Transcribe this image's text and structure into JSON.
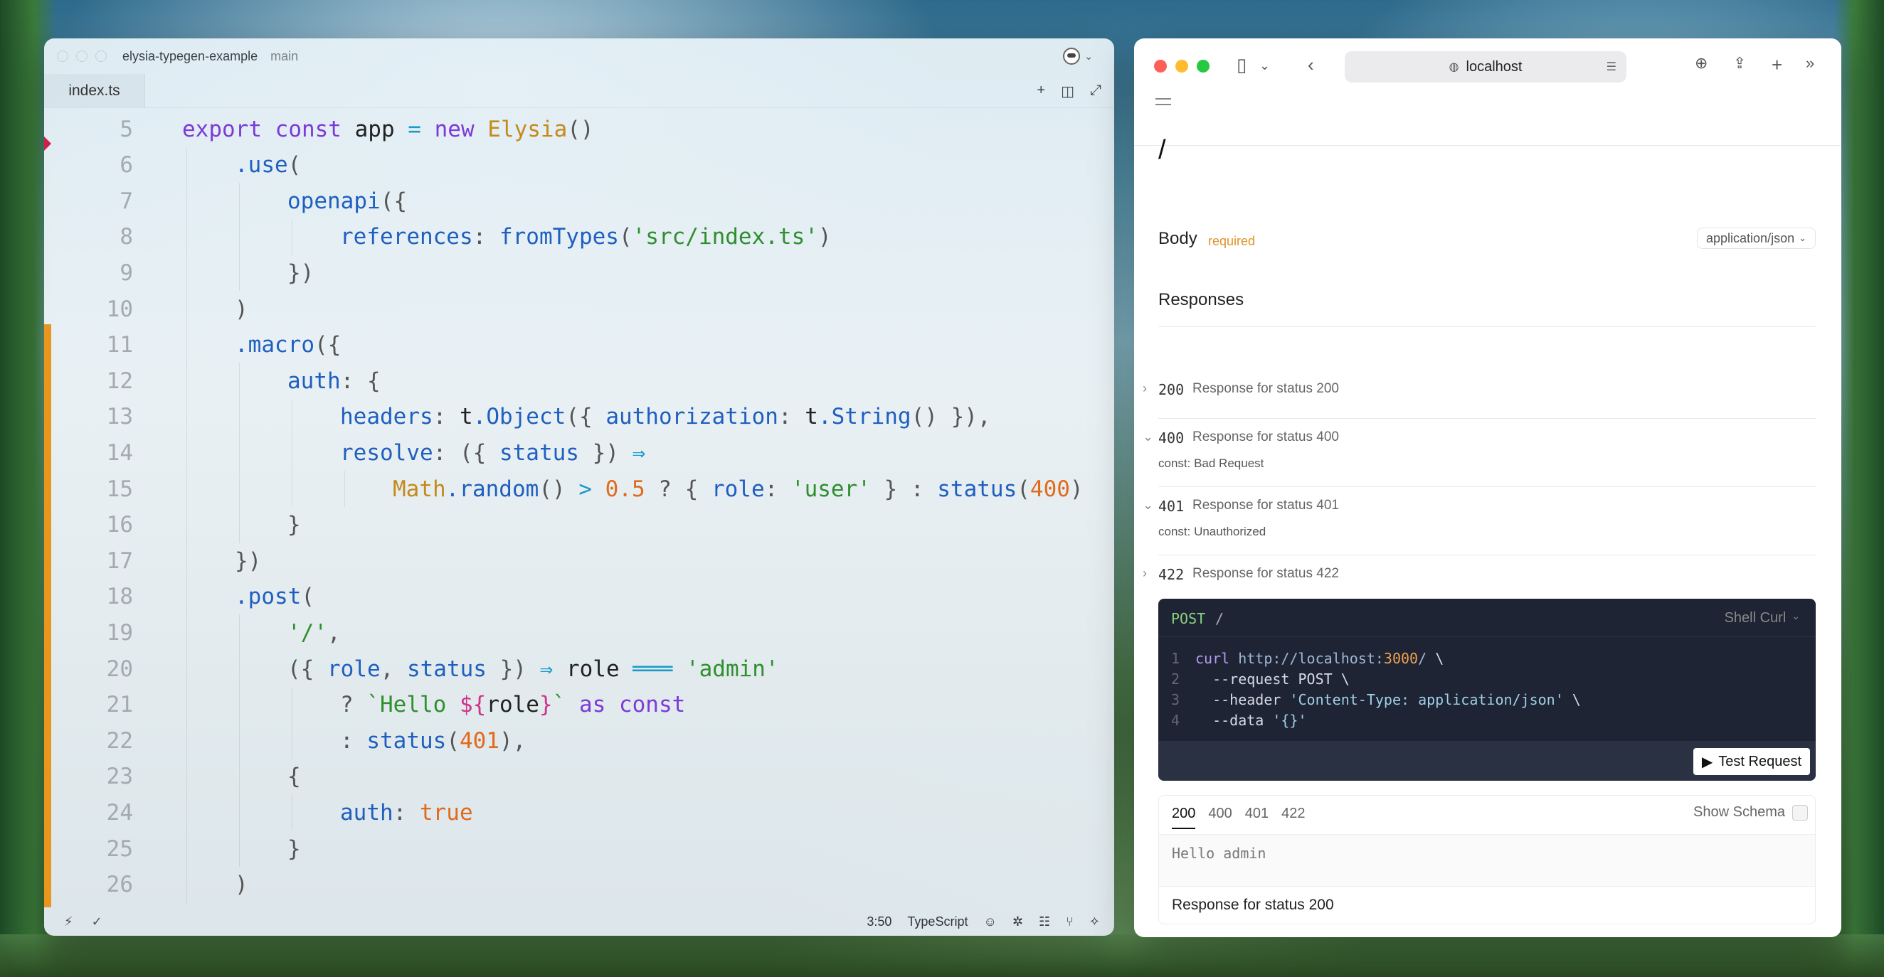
{
  "editor": {
    "project": "elysia-typegen-example",
    "branch": "main",
    "tab": "index.ts",
    "lines": [
      {
        "num": "5",
        "indent": 0,
        "tokens": [
          [
            "k",
            "export "
          ],
          [
            "k",
            "const "
          ],
          [
            "d",
            "app "
          ],
          [
            "o",
            "= "
          ],
          [
            "k",
            "new "
          ],
          [
            "c",
            "Elysia"
          ],
          [
            "p",
            "()"
          ]
        ]
      },
      {
        "num": "6",
        "indent": 1,
        "tokens": [
          [
            "f",
            ".use"
          ],
          [
            "p",
            "("
          ]
        ]
      },
      {
        "num": "7",
        "indent": 2,
        "tokens": [
          [
            "f",
            "openapi"
          ],
          [
            "p",
            "({"
          ]
        ]
      },
      {
        "num": "8",
        "indent": 3,
        "tokens": [
          [
            "f",
            "references"
          ],
          [
            "p",
            ": "
          ],
          [
            "f",
            "fromTypes"
          ],
          [
            "p",
            "("
          ],
          [
            "s",
            "'src/index.ts'"
          ],
          [
            "p",
            ")"
          ]
        ]
      },
      {
        "num": "9",
        "indent": 2,
        "tokens": [
          [
            "p",
            "})"
          ]
        ]
      },
      {
        "num": "10",
        "indent": 1,
        "tokens": [
          [
            "p",
            ")"
          ]
        ]
      },
      {
        "num": "11",
        "indent": 1,
        "tokens": [
          [
            "f",
            ".macro"
          ],
          [
            "p",
            "({"
          ]
        ]
      },
      {
        "num": "12",
        "indent": 2,
        "tokens": [
          [
            "f",
            "auth"
          ],
          [
            "p",
            ": {"
          ]
        ]
      },
      {
        "num": "13",
        "indent": 3,
        "tokens": [
          [
            "f",
            "headers"
          ],
          [
            "p",
            ": "
          ],
          [
            "d",
            "t"
          ],
          [
            "f",
            ".Object"
          ],
          [
            "p",
            "({ "
          ],
          [
            "f",
            "authorization"
          ],
          [
            "p",
            ": "
          ],
          [
            "d",
            "t"
          ],
          [
            "f",
            ".String"
          ],
          [
            "p",
            "() }),"
          ]
        ]
      },
      {
        "num": "14",
        "indent": 3,
        "tokens": [
          [
            "f",
            "resolve"
          ],
          [
            "p",
            ": ({ "
          ],
          [
            "f",
            "status "
          ],
          [
            "p",
            "}) "
          ],
          [
            "o",
            "⇒"
          ]
        ]
      },
      {
        "num": "15",
        "indent": 4,
        "tokens": [
          [
            "c",
            "Math"
          ],
          [
            "f",
            ".random"
          ],
          [
            "p",
            "() "
          ],
          [
            "o",
            "> "
          ],
          [
            "n",
            "0.5 "
          ],
          [
            "p",
            "? { "
          ],
          [
            "f",
            "role"
          ],
          [
            "p",
            ": "
          ],
          [
            "s",
            "'user' "
          ],
          [
            "p",
            "} : "
          ],
          [
            "f",
            "status"
          ],
          [
            "p",
            "("
          ],
          [
            "n",
            "400"
          ],
          [
            "p",
            ")"
          ]
        ]
      },
      {
        "num": "16",
        "indent": 2,
        "tokens": [
          [
            "p",
            "}"
          ]
        ]
      },
      {
        "num": "17",
        "indent": 1,
        "tokens": [
          [
            "p",
            "})"
          ]
        ]
      },
      {
        "num": "18",
        "indent": 1,
        "tokens": [
          [
            "f",
            ".post"
          ],
          [
            "p",
            "("
          ]
        ]
      },
      {
        "num": "19",
        "indent": 2,
        "tokens": [
          [
            "s",
            "'/'"
          ],
          [
            "p",
            ","
          ]
        ]
      },
      {
        "num": "20",
        "indent": 2,
        "tokens": [
          [
            "p",
            "({ "
          ],
          [
            "f",
            "role"
          ],
          [
            "p",
            ", "
          ],
          [
            "f",
            "status "
          ],
          [
            "p",
            "}) "
          ],
          [
            "o",
            "⇒ "
          ],
          [
            "d",
            "role "
          ],
          [
            "o",
            "═══ "
          ],
          [
            "s",
            "'admin'"
          ]
        ]
      },
      {
        "num": "21",
        "indent": 3,
        "tokens": [
          [
            "p",
            "? "
          ],
          [
            "s",
            "`Hello "
          ],
          [
            "pk",
            "${"
          ],
          [
            "d",
            "role"
          ],
          [
            "pk",
            "}"
          ],
          [
            "s",
            "` "
          ],
          [
            "k",
            "as const"
          ]
        ]
      },
      {
        "num": "22",
        "indent": 3,
        "tokens": [
          [
            "p",
            ": "
          ],
          [
            "f",
            "status"
          ],
          [
            "p",
            "("
          ],
          [
            "n",
            "401"
          ],
          [
            "p",
            "),"
          ]
        ]
      },
      {
        "num": "23",
        "indent": 2,
        "tokens": [
          [
            "p",
            "{"
          ]
        ]
      },
      {
        "num": "24",
        "indent": 3,
        "tokens": [
          [
            "f",
            "auth"
          ],
          [
            "p",
            ": "
          ],
          [
            "n",
            "true"
          ]
        ]
      },
      {
        "num": "25",
        "indent": 2,
        "tokens": [
          [
            "p",
            "}"
          ]
        ]
      },
      {
        "num": "26",
        "indent": 1,
        "tokens": [
          [
            "p",
            ")"
          ]
        ]
      }
    ],
    "status": {
      "cursor": "3:50",
      "language": "TypeScript"
    }
  },
  "browser": {
    "url": "localhost",
    "route": "/",
    "body_label": "Body",
    "required_label": "required",
    "content_type": "application/json",
    "responses_heading": "Responses",
    "responses": [
      {
        "code": "200",
        "desc": "Response for status 200",
        "expanded": false,
        "const": ""
      },
      {
        "code": "400",
        "desc": "Response for status 400",
        "expanded": true,
        "const": "const:  Bad Request"
      },
      {
        "code": "401",
        "desc": "Response for status 401",
        "expanded": true,
        "const": "const:  Unauthorized"
      },
      {
        "code": "422",
        "desc": "Response for status 422",
        "expanded": false,
        "const": ""
      }
    ],
    "request": {
      "method": "POST",
      "path": "/",
      "lang": "Shell Curl",
      "lines": [
        {
          "n": "1",
          "parts": [
            [
              "cmd",
              "curl "
            ],
            [
              "url",
              "http://localhost:"
            ],
            [
              "port",
              "3000"
            ],
            [
              "url",
              "/ "
            ],
            [
              "txt",
              "\\"
            ]
          ]
        },
        {
          "n": "2",
          "parts": [
            [
              "txt",
              "  --request POST \\"
            ]
          ]
        },
        {
          "n": "3",
          "parts": [
            [
              "txt",
              "  --header "
            ],
            [
              "str",
              "'Content-Type: application/json'"
            ],
            [
              "txt",
              " \\"
            ]
          ]
        },
        {
          "n": "4",
          "parts": [
            [
              "txt",
              "  --data "
            ],
            [
              "str",
              "'{}'"
            ]
          ]
        }
      ],
      "test_button": "Test Request"
    },
    "output": {
      "tabs": [
        "200",
        "400",
        "401",
        "422"
      ],
      "active_tab": "200",
      "show_schema": "Show Schema",
      "body": "Hello admin",
      "footer": "Response for status 200"
    }
  },
  "colors": {
    "accent_orange": "#e8971e",
    "required": "#e0922a",
    "code_bg": "#1e2433"
  }
}
